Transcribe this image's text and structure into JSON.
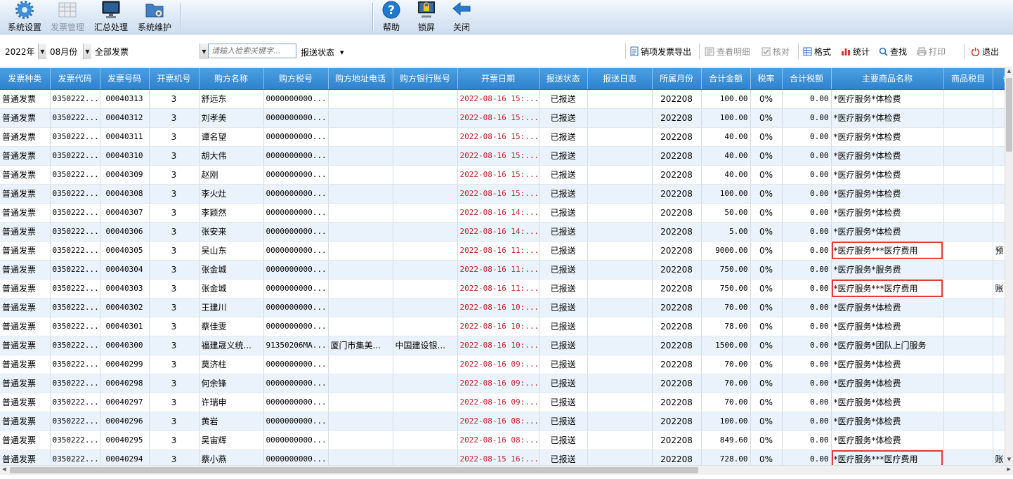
{
  "ribbon": {
    "system_settings": "系统设置",
    "invoice_management": "发票管理",
    "summary_processing": "汇总处理",
    "system_maintenance": "系统维护",
    "help": "帮助",
    "lock_screen": "锁屏",
    "close": "关闭"
  },
  "toolbar": {
    "year": "2022年",
    "month": "08月份",
    "invoice_scope": "全部发票",
    "search_placeholder": "请输入检索关键字...",
    "report_status": "报送状态",
    "export_items": "销项发票导出",
    "view_details": "查看明细",
    "verify": "核对",
    "format": "格式",
    "statistics": "统计",
    "find": "查找",
    "print": "打印",
    "exit": "退出"
  },
  "grid": {
    "columns": [
      "发票种类",
      "发票代码",
      "发票号码",
      "开票机号",
      "购方名称",
      "购方税号",
      "购方地址电话",
      "购方银行账号",
      "开票日期",
      "报送状态",
      "报送日志",
      "所属月份",
      "合计金额",
      "税率",
      "合计税额",
      "主要商品名称",
      "商品税目",
      "备"
    ],
    "rows": [
      {
        "kind": "普通发票",
        "code": "0350222...",
        "number": "00040313",
        "machine": "3",
        "buyer": "舒远东",
        "tax_id": "0000000000...",
        "addr": "",
        "bank": "",
        "date": "2022-08-16 15:...",
        "status": "已报送",
        "log": "",
        "month": "202208",
        "amount": "100.00",
        "rate": "0%",
        "tax": "0.00",
        "goods": "*医疗服务*体检费",
        "item": "",
        "note": ""
      },
      {
        "kind": "普通发票",
        "code": "0350222...",
        "number": "00040312",
        "machine": "3",
        "buyer": "刘孝美",
        "tax_id": "0000000000...",
        "addr": "",
        "bank": "",
        "date": "2022-08-16 15:...",
        "status": "已报送",
        "log": "",
        "month": "202208",
        "amount": "100.00",
        "rate": "0%",
        "tax": "0.00",
        "goods": "*医疗服务*体检费",
        "item": "",
        "note": ""
      },
      {
        "kind": "普通发票",
        "code": "0350222...",
        "number": "00040311",
        "machine": "3",
        "buyer": "谭名望",
        "tax_id": "0000000000...",
        "addr": "",
        "bank": "",
        "date": "2022-08-16 15:...",
        "status": "已报送",
        "log": "",
        "month": "202208",
        "amount": "40.00",
        "rate": "0%",
        "tax": "0.00",
        "goods": "*医疗服务*体检费",
        "item": "",
        "note": ""
      },
      {
        "kind": "普通发票",
        "code": "0350222...",
        "number": "00040310",
        "machine": "3",
        "buyer": "胡大伟",
        "tax_id": "0000000000...",
        "addr": "",
        "bank": "",
        "date": "2022-08-16 15:...",
        "status": "已报送",
        "log": "",
        "month": "202208",
        "amount": "40.00",
        "rate": "0%",
        "tax": "0.00",
        "goods": "*医疗服务*体检费",
        "item": "",
        "note": ""
      },
      {
        "kind": "普通发票",
        "code": "0350222...",
        "number": "00040309",
        "machine": "3",
        "buyer": "赵刚",
        "tax_id": "0000000000...",
        "addr": "",
        "bank": "",
        "date": "2022-08-16 15:...",
        "status": "已报送",
        "log": "",
        "month": "202208",
        "amount": "40.00",
        "rate": "0%",
        "tax": "0.00",
        "goods": "*医疗服务*体检费",
        "item": "",
        "note": ""
      },
      {
        "kind": "普通发票",
        "code": "0350222...",
        "number": "00040308",
        "machine": "3",
        "buyer": "李火灶",
        "tax_id": "0000000000...",
        "addr": "",
        "bank": "",
        "date": "2022-08-16 15:...",
        "status": "已报送",
        "log": "",
        "month": "202208",
        "amount": "100.00",
        "rate": "0%",
        "tax": "0.00",
        "goods": "*医疗服务*体检费",
        "item": "",
        "note": ""
      },
      {
        "kind": "普通发票",
        "code": "0350222...",
        "number": "00040307",
        "machine": "3",
        "buyer": "李颖然",
        "tax_id": "0000000000...",
        "addr": "",
        "bank": "",
        "date": "2022-08-16 14:...",
        "status": "已报送",
        "log": "",
        "month": "202208",
        "amount": "50.00",
        "rate": "0%",
        "tax": "0.00",
        "goods": "*医疗服务*体检费",
        "item": "",
        "note": ""
      },
      {
        "kind": "普通发票",
        "code": "0350222...",
        "number": "00040306",
        "machine": "3",
        "buyer": "张安来",
        "tax_id": "0000000000...",
        "addr": "",
        "bank": "",
        "date": "2022-08-16 14:...",
        "status": "已报送",
        "log": "",
        "month": "202208",
        "amount": "5.00",
        "rate": "0%",
        "tax": "0.00",
        "goods": "*医疗服务*体检费",
        "item": "",
        "note": ""
      },
      {
        "kind": "普通发票",
        "code": "0350222...",
        "number": "00040305",
        "machine": "3",
        "buyer": "吴山东",
        "tax_id": "0000000000...",
        "addr": "",
        "bank": "",
        "date": "2022-08-16 11:...",
        "status": "已报送",
        "log": "",
        "month": "202208",
        "amount": "9000.00",
        "rate": "0%",
        "tax": "0.00",
        "goods": "*医疗服务***医疗费用",
        "item": "",
        "note": "预",
        "highlight": true
      },
      {
        "kind": "普通发票",
        "code": "0350222...",
        "number": "00040304",
        "machine": "3",
        "buyer": "张金城",
        "tax_id": "0000000000...",
        "addr": "",
        "bank": "",
        "date": "2022-08-16 11:...",
        "status": "已报送",
        "log": "",
        "month": "202208",
        "amount": "750.00",
        "rate": "0%",
        "tax": "0.00",
        "goods": "*医疗服务*服务费",
        "item": "",
        "note": ""
      },
      {
        "kind": "普通发票",
        "code": "0350222...",
        "number": "00040303",
        "machine": "3",
        "buyer": "张金城",
        "tax_id": "0000000000...",
        "addr": "",
        "bank": "",
        "date": "2022-08-16 11:...",
        "status": "已报送",
        "log": "",
        "month": "202208",
        "amount": "750.00",
        "rate": "0%",
        "tax": "0.00",
        "goods": "*医疗服务***医疗费用",
        "item": "",
        "note": "账",
        "highlight": true
      },
      {
        "kind": "普通发票",
        "code": "0350222...",
        "number": "00040302",
        "machine": "3",
        "buyer": "王建川",
        "tax_id": "0000000000...",
        "addr": "",
        "bank": "",
        "date": "2022-08-16 10:...",
        "status": "已报送",
        "log": "",
        "month": "202208",
        "amount": "70.00",
        "rate": "0%",
        "tax": "0.00",
        "goods": "*医疗服务*体检费",
        "item": "",
        "note": ""
      },
      {
        "kind": "普通发票",
        "code": "0350222...",
        "number": "00040301",
        "machine": "3",
        "buyer": "蔡佳雯",
        "tax_id": "0000000000...",
        "addr": "",
        "bank": "",
        "date": "2022-08-16 10:...",
        "status": "已报送",
        "log": "",
        "month": "202208",
        "amount": "78.00",
        "rate": "0%",
        "tax": "0.00",
        "goods": "*医疗服务*体检费",
        "item": "",
        "note": ""
      },
      {
        "kind": "普通发票",
        "code": "0350222...",
        "number": "00040300",
        "machine": "3",
        "buyer": "福建晟义统...",
        "tax_id": "91350206MA...",
        "addr": "厦门市集美...",
        "bank": "中国建设银...",
        "date": "2022-08-16 10:...",
        "status": "已报送",
        "log": "",
        "month": "202208",
        "amount": "1500.00",
        "rate": "0%",
        "tax": "0.00",
        "goods": "*医疗服务*团队上门服务",
        "item": "",
        "note": ""
      },
      {
        "kind": "普通发票",
        "code": "0350222...",
        "number": "00040299",
        "machine": "3",
        "buyer": "莫济柱",
        "tax_id": "0000000000...",
        "addr": "",
        "bank": "",
        "date": "2022-08-16 09:...",
        "status": "已报送",
        "log": "",
        "month": "202208",
        "amount": "70.00",
        "rate": "0%",
        "tax": "0.00",
        "goods": "*医疗服务*体检费",
        "item": "",
        "note": ""
      },
      {
        "kind": "普通发票",
        "code": "0350222...",
        "number": "00040298",
        "machine": "3",
        "buyer": "何余锋",
        "tax_id": "0000000000...",
        "addr": "",
        "bank": "",
        "date": "2022-08-16 09:...",
        "status": "已报送",
        "log": "",
        "month": "202208",
        "amount": "70.00",
        "rate": "0%",
        "tax": "0.00",
        "goods": "*医疗服务*体检费",
        "item": "",
        "note": ""
      },
      {
        "kind": "普通发票",
        "code": "0350222...",
        "number": "00040297",
        "machine": "3",
        "buyer": "许瑞申",
        "tax_id": "0000000000...",
        "addr": "",
        "bank": "",
        "date": "2022-08-16 09:...",
        "status": "已报送",
        "log": "",
        "month": "202208",
        "amount": "70.00",
        "rate": "0%",
        "tax": "0.00",
        "goods": "*医疗服务*体检费",
        "item": "",
        "note": ""
      },
      {
        "kind": "普通发票",
        "code": "0350222...",
        "number": "00040296",
        "machine": "3",
        "buyer": "黄岩",
        "tax_id": "0000000000...",
        "addr": "",
        "bank": "",
        "date": "2022-08-16 08:...",
        "status": "已报送",
        "log": "",
        "month": "202208",
        "amount": "100.00",
        "rate": "0%",
        "tax": "0.00",
        "goods": "*医疗服务*体检费",
        "item": "",
        "note": ""
      },
      {
        "kind": "普通发票",
        "code": "0350222...",
        "number": "00040295",
        "machine": "3",
        "buyer": "吴宙辉",
        "tax_id": "0000000000...",
        "addr": "",
        "bank": "",
        "date": "2022-08-16 08:...",
        "status": "已报送",
        "log": "",
        "month": "202208",
        "amount": "849.60",
        "rate": "0%",
        "tax": "0.00",
        "goods": "*医疗服务*体检费",
        "item": "",
        "note": ""
      },
      {
        "kind": "普通发票",
        "code": "0350222...",
        "number": "00040294",
        "machine": "3",
        "buyer": "蔡小燕",
        "tax_id": "0000000000...",
        "addr": "",
        "bank": "",
        "date": "2022-08-15 16:...",
        "status": "已报送",
        "log": "",
        "month": "202208",
        "amount": "728.00",
        "rate": "0%",
        "tax": "0.00",
        "goods": "*医疗服务***医疗费用",
        "item": "",
        "note": "账",
        "highlight": true
      }
    ]
  },
  "colors": {
    "header_bg": "#3a8dd6",
    "date_text": "#c0202a",
    "highlight_border": "#e33a3a",
    "row_alt": "#eaf3fb"
  }
}
